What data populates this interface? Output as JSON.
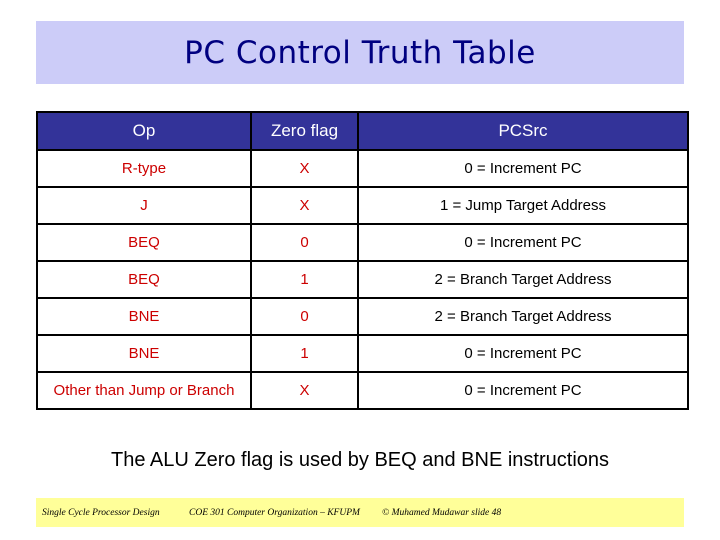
{
  "slide": {
    "title": "PC Control Truth Table",
    "colors": {
      "title_bg": "#ccccf8",
      "title_text": "#000080",
      "header_bg": "#333399",
      "header_text": "#ffffff",
      "body_red": "#cc0000",
      "footer_bg": "#ffff99"
    }
  },
  "table": {
    "headers": [
      "Op",
      "Zero flag",
      "PCSrc"
    ],
    "rows": [
      {
        "op": "R-type",
        "zero": "X",
        "pcsrc": "0 = Increment PC"
      },
      {
        "op": "J",
        "zero": "X",
        "pcsrc": "1 = Jump Target Address"
      },
      {
        "op": "BEQ",
        "zero": "0",
        "pcsrc": "0 = Increment PC"
      },
      {
        "op": "BEQ",
        "zero": "1",
        "pcsrc": "2 = Branch Target Address"
      },
      {
        "op": "BNE",
        "zero": "0",
        "pcsrc": "2 = Branch Target Address"
      },
      {
        "op": "BNE",
        "zero": "1",
        "pcsrc": "0 = Increment PC"
      },
      {
        "op": "Other than Jump or Branch",
        "zero": "X",
        "pcsrc": "0 = Increment PC"
      }
    ]
  },
  "note": "The ALU Zero flag is used by BEQ and BNE instructions",
  "footer": {
    "left": "Single Cycle Processor Design",
    "center": "COE 301 Computer Organization – KFUPM",
    "right": "© Muhamed Mudawar slide 48"
  }
}
